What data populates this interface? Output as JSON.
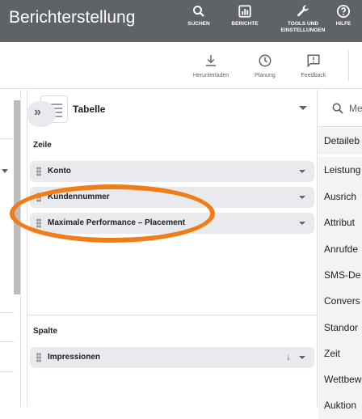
{
  "header": {
    "title": "Berichterstellung",
    "bg_color": "#5f6368",
    "nav": [
      {
        "icon": "search-icon",
        "label": "SUCHEN"
      },
      {
        "icon": "reports-icon",
        "label": "BERICHTE"
      },
      {
        "icon": "wrench-icon",
        "label_line1": "TOOLS UND",
        "label_line2": "EINSTELLUNGEN"
      },
      {
        "icon": "help-icon",
        "label": "HILFE"
      }
    ]
  },
  "toolbar": {
    "download_label": "Herunterladen",
    "schedule_label": "Planung",
    "feedback_label": "Feedback"
  },
  "editor": {
    "chart_type": "Tabelle",
    "row_section": "Zeile",
    "row_chips": [
      "Konto",
      "Kundennummer",
      "Maximale Performance – Placement"
    ],
    "column_section": "Spalte",
    "column_chips": [
      "Impressionen"
    ]
  },
  "right_panel": {
    "search_placeholder": "Me",
    "items": [
      "Detaileb",
      "Leistung",
      "Ausrich",
      "Attribut",
      "Anrufde",
      "SMS-De",
      "Convers",
      "Standor",
      "Zeit",
      "Wettbew",
      "Auktion"
    ]
  },
  "highlight_color": "#f07d18"
}
